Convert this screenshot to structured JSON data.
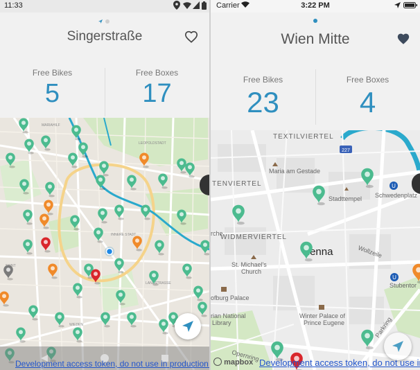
{
  "android": {
    "status": {
      "time": "11:33"
    },
    "station_name": "Singerstraße",
    "free_bikes_label": "Free Bikes",
    "free_bikes_value": "5",
    "free_boxes_label": "Free Boxes",
    "free_boxes_value": "17",
    "favorite_icon": "heart-outline-icon",
    "banner": "Development access token, do not use in production."
  },
  "ios": {
    "status": {
      "carrier": "Carrier",
      "time": "3:22 PM"
    },
    "station_name": "Wien Mitte",
    "free_bikes_label": "Free Bikes",
    "free_bikes_value": "23",
    "free_boxes_label": "Free Boxes",
    "free_boxes_value": "4",
    "favorite_icon": "heart-filled-icon",
    "map_labels": {
      "textilviertel": "TEXTILVIERTEL",
      "tenviertel": "TENVIERTEL",
      "widmerviertel": "WIDMERVIERTEL",
      "maria_am_gestade": "Maria am Gestade",
      "stadttempel": "Stadttempel",
      "schwedenplatz": "Schwedenplatz",
      "vienna": "Vienna",
      "wollzeile": "Wollzeile",
      "st_michaels": "St. Michael's",
      "church": "Church",
      "hofburg": "ofburg Palace",
      "austrian": "rian National",
      "library": "Library",
      "winter_palace_1": "Winter Palace of",
      "winter_palace_2": "Prince Eugene",
      "stubentor": "Stubentor",
      "parkring": "Parkring",
      "opernring": "Opernring",
      "rche": "rche",
      "route": "227"
    },
    "mapbox": "mapbox",
    "banner": "Development access token, do not use in"
  },
  "colors": {
    "accent": "#2f8fbf",
    "marker_green": "#4cbb8f",
    "marker_orange": "#f08a2a",
    "marker_red": "#d9262b",
    "marker_gray": "#7b7b7b"
  }
}
